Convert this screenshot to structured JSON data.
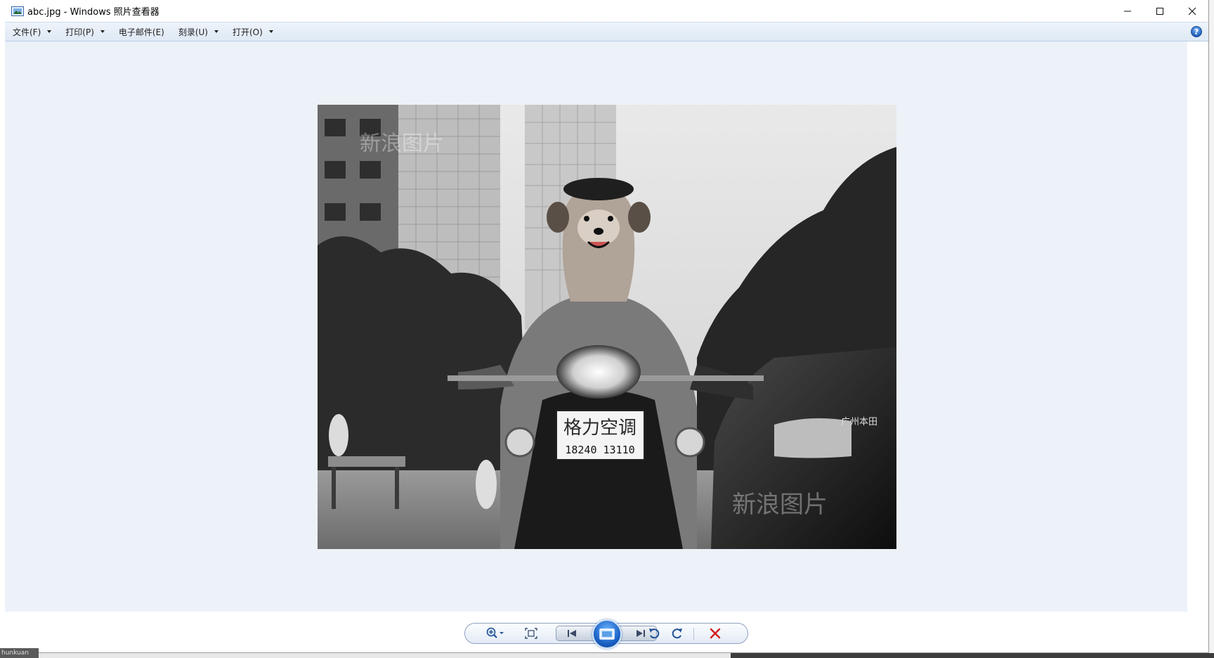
{
  "window": {
    "title": "abc.jpg - Windows 照片查看器"
  },
  "menu": {
    "items": [
      {
        "label": "文件(F)",
        "has_dropdown": true
      },
      {
        "label": "打印(P)",
        "has_dropdown": true
      },
      {
        "label": "电子邮件(E)",
        "has_dropdown": false
      },
      {
        "label": "刻录(U)",
        "has_dropdown": true
      },
      {
        "label": "打开(O)",
        "has_dropdown": true
      }
    ]
  },
  "photo": {
    "license_plate_text": "格力空调",
    "license_plate_number": "18240 13110",
    "watermark": "新浪图片",
    "car_badge": "广州本田"
  },
  "toolbar": {
    "buttons": [
      "zoom-icon",
      "actual-size-icon",
      "previous-icon",
      "slideshow-icon",
      "next-icon",
      "rotate-left-icon",
      "rotate-right-icon",
      "delete-icon"
    ]
  },
  "taskbar": {
    "thumb_label": "hunkuan"
  },
  "colors": {
    "viewer_background": "#edf2f9",
    "menubar": "#e6eef8",
    "delete_red": "#d21e1e",
    "slideshow_blue": "#1b62c6"
  }
}
